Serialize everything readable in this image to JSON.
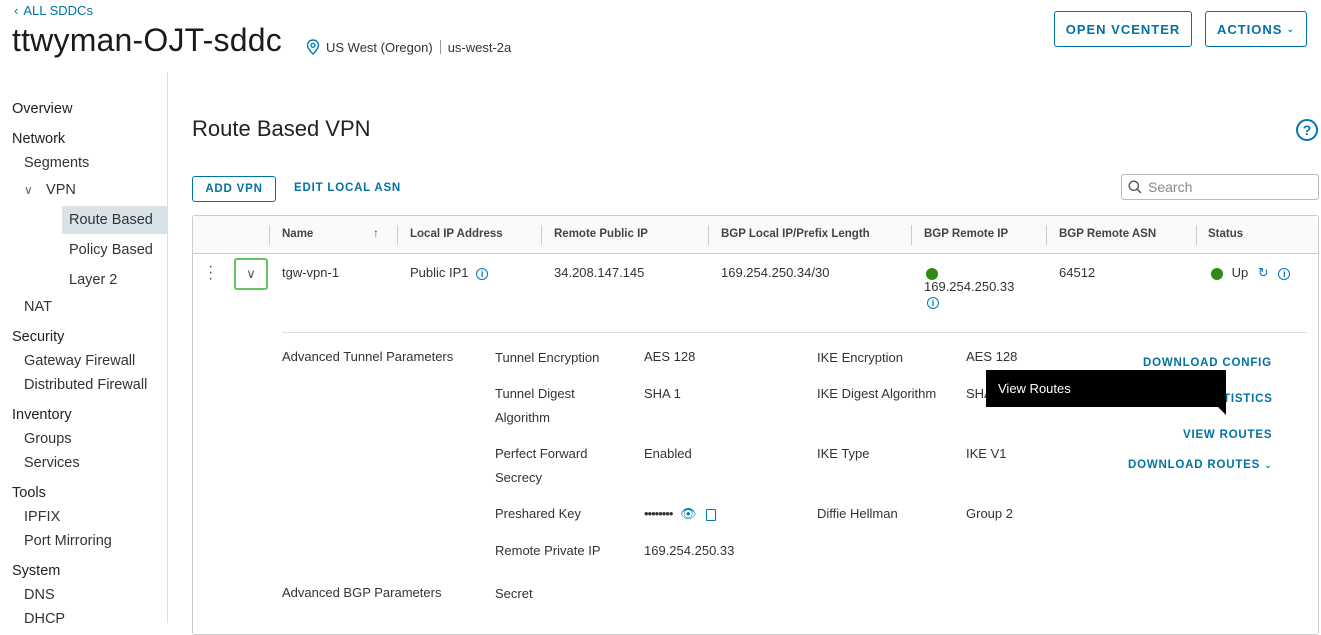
{
  "header": {
    "back_label": "ALL SDDCs",
    "sddc_name": "ttwyman-OJT-sddc",
    "region": "US West (Oregon)",
    "zone": "us-west-2a",
    "open_vcenter": "OPEN VCENTER",
    "actions": "ACTIONS"
  },
  "sidebar": {
    "overview": "Overview",
    "network": "Network",
    "segments": "Segments",
    "vpn": "VPN",
    "route_based": "Route Based",
    "policy_based": "Policy Based",
    "layer2": "Layer 2",
    "nat": "NAT",
    "security": "Security",
    "gateway_firewall": "Gateway Firewall",
    "distributed_firewall": "Distributed Firewall",
    "inventory": "Inventory",
    "groups": "Groups",
    "services": "Services",
    "tools": "Tools",
    "ipfix": "IPFIX",
    "port_mirroring": "Port Mirroring",
    "system": "System",
    "dns": "DNS",
    "dhcp": "DHCP"
  },
  "main": {
    "title": "Route Based VPN",
    "add_vpn": "ADD VPN",
    "edit_local_asn": "EDIT LOCAL ASN",
    "search_placeholder": "Search"
  },
  "table": {
    "columns": {
      "name": "Name",
      "local_ip": "Local IP Address",
      "remote_public_ip": "Remote Public IP",
      "bgp_local": "BGP Local IP/Prefix Length",
      "bgp_remote_ip": "BGP Remote IP",
      "bgp_remote_asn": "BGP Remote ASN",
      "status": "Status"
    },
    "row": {
      "name": "tgw-vpn-1",
      "local_ip": "Public IP1",
      "remote_public_ip": "34.208.147.145",
      "bgp_local": "169.254.250.34/30",
      "bgp_remote_ip": "169.254.250.33",
      "bgp_remote_asn": "64512",
      "status": "Up"
    }
  },
  "details": {
    "adv_tunnel": "Advanced Tunnel Parameters",
    "tunnel_encryption_label": "Tunnel Encryption",
    "tunnel_encryption": "AES 128",
    "tunnel_digest_label_1": "Tunnel Digest",
    "tunnel_digest_label_2": "Algorithm",
    "tunnel_digest": "SHA 1",
    "pfs_label_1": "Perfect Forward",
    "pfs_label_2": "Secrecy",
    "pfs": "Enabled",
    "psk_label": "Preshared Key",
    "psk": "••••••••",
    "remote_private_ip_label": "Remote Private IP",
    "remote_private_ip": "169.254.250.33",
    "ike_encryption_label": "IKE Encryption",
    "ike_encryption": "AES 128",
    "ike_digest_label": "IKE Digest Algorithm",
    "ike_digest": "SHA",
    "ike_type_label": "IKE Type",
    "ike_type": "IKE V1",
    "dh_label": "Diffie Hellman",
    "dh": "Group 2",
    "adv_bgp": "Advanced BGP Parameters",
    "secret_label": "Secret",
    "download_config": "DOWNLOAD CONFIG",
    "statistics_partial": "TISTICS",
    "view_routes": "VIEW ROUTES",
    "download_routes": "DOWNLOAD ROUTES",
    "tooltip": "View Routes"
  }
}
